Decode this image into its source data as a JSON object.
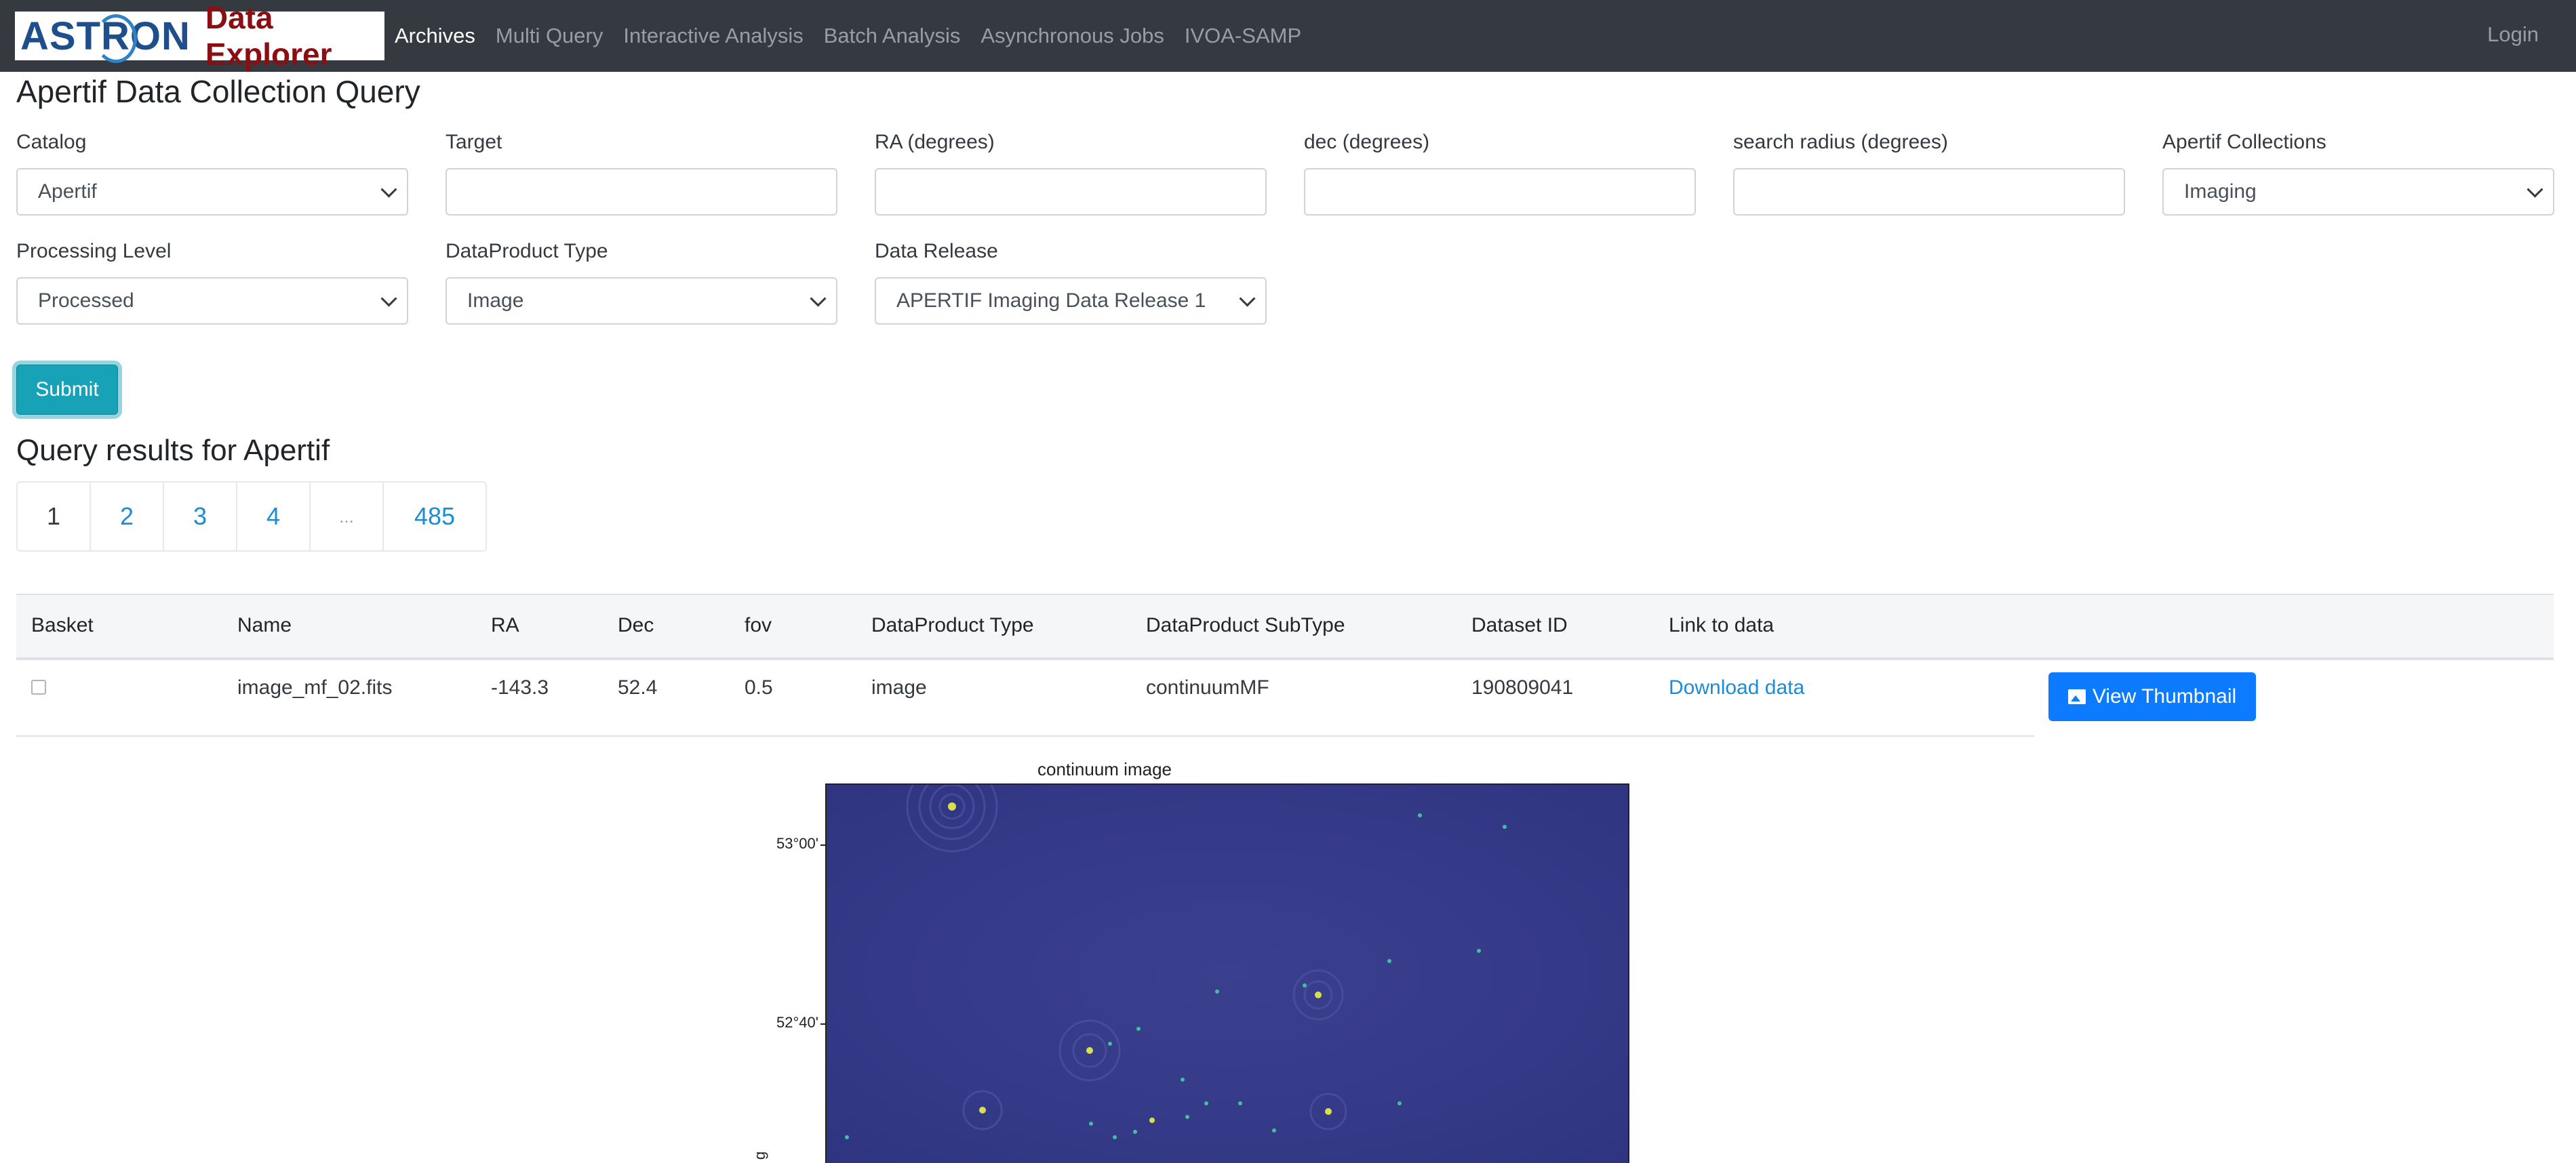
{
  "navbar": {
    "logo_text": "ASTRON",
    "logo_subtext": "Data Explorer",
    "items": [
      {
        "label": "Archives",
        "active": true
      },
      {
        "label": "Multi Query",
        "active": false
      },
      {
        "label": "Interactive Analysis",
        "active": false
      },
      {
        "label": "Batch Analysis",
        "active": false
      },
      {
        "label": "Asynchronous Jobs",
        "active": false
      },
      {
        "label": "IVOA-SAMP",
        "active": false
      }
    ],
    "login": "Login"
  },
  "form": {
    "title": "Apertif Data Collection Query",
    "catalog": {
      "label": "Catalog",
      "value": "Apertif"
    },
    "target": {
      "label": "Target",
      "value": ""
    },
    "ra": {
      "label": "RA (degrees)",
      "value": ""
    },
    "dec": {
      "label": "dec (degrees)",
      "value": ""
    },
    "radius": {
      "label": "search radius (degrees)",
      "value": ""
    },
    "collections": {
      "label": "Apertif Collections",
      "value": "Imaging"
    },
    "processing_level": {
      "label": "Processing Level",
      "value": "Processed"
    },
    "dataproduct_type": {
      "label": "DataProduct Type",
      "value": "Image"
    },
    "data_release": {
      "label": "Data Release",
      "value": "APERTIF Imaging Data Release 1"
    },
    "submit": "Submit"
  },
  "results": {
    "title": "Query results for Apertif",
    "pages": [
      "1",
      "2",
      "3",
      "4",
      "...",
      "485"
    ],
    "columns": [
      "Basket",
      "Name",
      "RA",
      "Dec",
      "fov",
      "DataProduct Type",
      "DataProduct SubType",
      "Dataset ID",
      "Link to data"
    ],
    "row": {
      "name": "image_mf_02.fits",
      "ra": "-143.3",
      "dec": "52.4",
      "fov": "0.5",
      "dataproduct_type": "image",
      "dataproduct_subtype": "continuumMF",
      "dataset_id": "190809041",
      "link": "Download data",
      "thumbnail_button": "View Thumbnail"
    }
  },
  "thumbnail": {
    "title": "continuum image",
    "yticks": [
      "53°00'",
      "52°40'"
    ],
    "ylabel": "g"
  },
  "colors": {
    "navbar_bg": "#343a40",
    "submit_bg": "#17a2b8",
    "primary": "#0d7bff",
    "link": "#1a8cd8",
    "plot_bg": "#353a88"
  }
}
